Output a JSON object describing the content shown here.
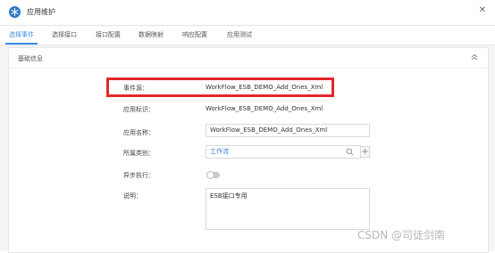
{
  "window": {
    "title": "应用维护",
    "close_glyph": "✕",
    "app_icon": "snowflake-icon"
  },
  "tabs": [
    {
      "label": "选择事件",
      "active": true
    },
    {
      "label": "选择接口",
      "active": false
    },
    {
      "label": "接口配置",
      "active": false
    },
    {
      "label": "数据映射",
      "active": false
    },
    {
      "label": "响应配置",
      "active": false
    },
    {
      "label": "应用测试",
      "active": false
    }
  ],
  "panel": {
    "title": "基础信息",
    "collapse_icon": "chevron-up-icon"
  },
  "form": {
    "event_source": {
      "label": "事件源：",
      "value": "WorkFlow_ESB_DEMO_Add_Ones_Xml"
    },
    "app_id": {
      "label": "应用标识：",
      "value": "WorkFlow_ESB_DEMO_Add_Ones_Xml"
    },
    "app_name": {
      "label": "应用名称：",
      "value": "WorkFlow_ESB_DEMO_Add_Ones_Xml"
    },
    "category": {
      "label": "所属类别：",
      "value": "工作流",
      "add_glyph": "+"
    },
    "async": {
      "label": "异步执行：",
      "enabled": false
    },
    "description": {
      "label": "说明：",
      "value": "ESB接口专用"
    }
  },
  "watermark": "CSDN @司徒剑南",
  "colors": {
    "accent": "#3a8ee6",
    "highlight": "#e3272d",
    "link": "#3a7bd5"
  }
}
